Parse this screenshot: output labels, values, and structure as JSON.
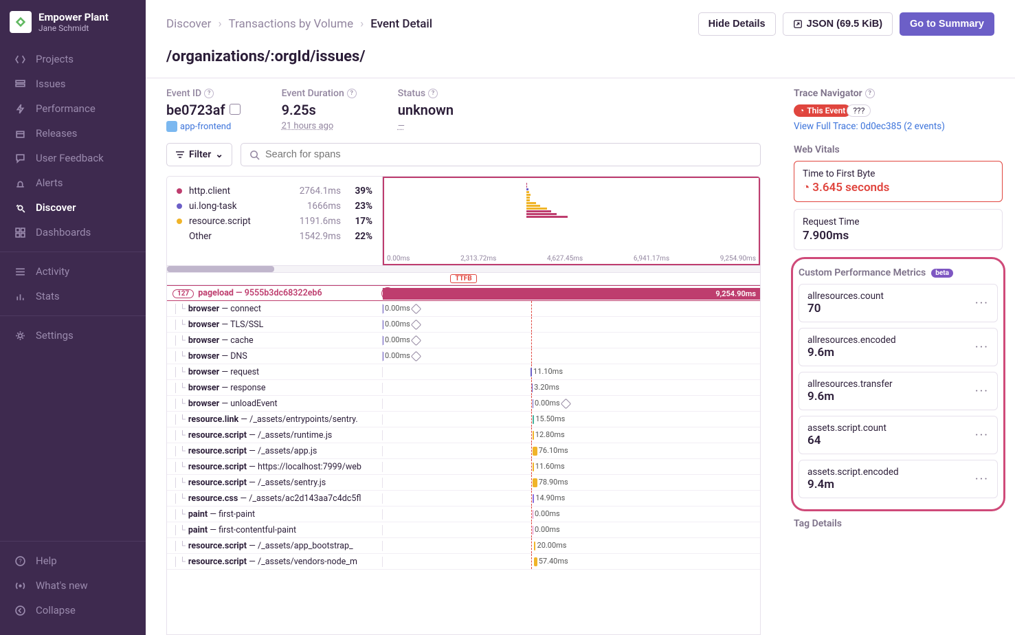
{
  "org": {
    "name": "Empower Plant",
    "user": "Jane Schmidt"
  },
  "nav": {
    "items": [
      {
        "label": "Projects",
        "icon": "code-brackets"
      },
      {
        "label": "Issues",
        "icon": "stack"
      },
      {
        "label": "Performance",
        "icon": "bolt"
      },
      {
        "label": "Releases",
        "icon": "box"
      },
      {
        "label": "User Feedback",
        "icon": "speech"
      },
      {
        "label": "Alerts",
        "icon": "siren"
      },
      {
        "label": "Discover",
        "icon": "telescope",
        "active": true
      },
      {
        "label": "Dashboards",
        "icon": "grid"
      }
    ],
    "group2": [
      {
        "label": "Activity",
        "icon": "list"
      },
      {
        "label": "Stats",
        "icon": "bar-chart"
      }
    ],
    "group3": [
      {
        "label": "Settings",
        "icon": "gear"
      }
    ],
    "footer": [
      {
        "label": "Help",
        "icon": "help"
      },
      {
        "label": "What's new",
        "icon": "broadcast"
      },
      {
        "label": "Collapse",
        "icon": "chevron-left"
      }
    ]
  },
  "breadcrumb": [
    "Discover",
    "Transactions by Volume",
    "Event Detail"
  ],
  "actions": {
    "hide": "Hide Details",
    "json": "JSON (69.5 KiB)",
    "summary": "Go to Summary"
  },
  "page_title": "/organizations/:orgId/issues/",
  "meta": {
    "event_id": {
      "label": "Event ID",
      "value": "be0723af",
      "project": "app-frontend"
    },
    "duration": {
      "label": "Event Duration",
      "value": "9.25s",
      "sub": "21 hours ago"
    },
    "status": {
      "label": "Status",
      "value": "unknown",
      "sub": "—"
    }
  },
  "filter": {
    "label": "Filter"
  },
  "search": {
    "placeholder": "Search for spans"
  },
  "ops_breakdown": [
    {
      "name": "http.client",
      "ms": "2764.1ms",
      "pct": "39%",
      "color": "#be3d6e"
    },
    {
      "name": "ui.long-task",
      "ms": "1666ms",
      "pct": "23%",
      "color": "#6c5fc7"
    },
    {
      "name": "resource.script",
      "ms": "1191.6ms",
      "pct": "17%",
      "color": "#f0b429"
    },
    {
      "name": "Other",
      "ms": "1542.9ms",
      "pct": "22%",
      "color": "transparent"
    }
  ],
  "mini_axis": [
    "0.00ms",
    "2,313.72ms",
    "4,627.45ms",
    "6,941.17ms",
    "9,254.90ms"
  ],
  "ttfb_label": "TTFB",
  "pageload": {
    "count": "127",
    "label": "pageload",
    "id": "9555b3dc68322eb6",
    "total": "9,254.90ms"
  },
  "spans": [
    {
      "op": "browser",
      "desc": "connect",
      "offset": 0,
      "w": 0,
      "ms": "0.00ms",
      "warn": true,
      "color": "#6c5fc7"
    },
    {
      "op": "browser",
      "desc": "TLS/SSL",
      "offset": 0,
      "w": 0,
      "ms": "0.00ms",
      "warn": true,
      "color": "#6c5fc7"
    },
    {
      "op": "browser",
      "desc": "cache",
      "offset": 0,
      "w": 0,
      "ms": "0.00ms",
      "warn": true,
      "color": "#6c5fc7"
    },
    {
      "op": "browser",
      "desc": "DNS",
      "offset": 0,
      "w": 0,
      "ms": "0.00ms",
      "warn": true,
      "color": "#6c5fc7"
    },
    {
      "op": "browser",
      "desc": "request",
      "offset": 39.2,
      "w": 0.3,
      "ms": "11.10ms",
      "color": "#6c5fc7"
    },
    {
      "op": "browser",
      "desc": "response",
      "offset": 39.5,
      "w": 0.2,
      "ms": "3.20ms",
      "color": "#6c5fc7"
    },
    {
      "op": "browser",
      "desc": "unloadEvent",
      "offset": 39.7,
      "w": 0,
      "ms": "0.00ms",
      "warn": true,
      "color": "#6c5fc7"
    },
    {
      "op": "resource.link",
      "desc": "/_assets/entrypoints/sentry.",
      "offset": 39.7,
      "w": 0.4,
      "ms": "15.50ms",
      "color": "#46b29d"
    },
    {
      "op": "resource.script",
      "desc": "/_assets/runtime.js",
      "offset": 39.7,
      "w": 0.3,
      "ms": "12.80ms",
      "color": "#f0b429"
    },
    {
      "op": "resource.script",
      "desc": "/_assets/app.js",
      "offset": 39.7,
      "w": 1.2,
      "ms": "76.10ms",
      "color": "#f0b429"
    },
    {
      "op": "resource.script",
      "desc": "https://localhost:7999/web",
      "offset": 39.7,
      "w": 0.3,
      "ms": "11.60ms",
      "color": "#f0b429"
    },
    {
      "op": "resource.script",
      "desc": "/_assets/sentry.js",
      "offset": 39.7,
      "w": 1.2,
      "ms": "78.90ms",
      "color": "#f0b429"
    },
    {
      "op": "resource.css",
      "desc": "/_assets/ac2d143aa7c4dc5fl",
      "offset": 39.7,
      "w": 0.4,
      "ms": "14.90ms",
      "color": "#8c6fe0"
    },
    {
      "op": "paint",
      "desc": "first-paint",
      "offset": 39.7,
      "w": 0,
      "ms": "0.00ms",
      "color": "#e07bc2"
    },
    {
      "op": "paint",
      "desc": "first-contentful-paint",
      "offset": 39.7,
      "w": 0,
      "ms": "0.00ms",
      "color": "#e07bc2"
    },
    {
      "op": "resource.script",
      "desc": "/_assets/app_bootstrap_",
      "offset": 40.0,
      "w": 0.5,
      "ms": "20.00ms",
      "color": "#f0b429"
    },
    {
      "op": "resource.script",
      "desc": "/_assets/vendors-node_m",
      "offset": 40.0,
      "w": 0.9,
      "ms": "57.40ms",
      "color": "#f0b429"
    }
  ],
  "trace_nav": {
    "title": "Trace Navigator",
    "chip": "This Event",
    "q": "???",
    "link": "View Full Trace: 0d0ec385 (2 events)"
  },
  "web_vitals": {
    "title": "Web Vitals",
    "ttfb": {
      "k": "Time to First Byte",
      "v": "3.645 seconds"
    },
    "req": {
      "k": "Request Time",
      "v": "7.900ms"
    }
  },
  "custom_metrics": {
    "title": "Custom Performance Metrics",
    "badge": "beta",
    "items": [
      {
        "k": "allresources.count",
        "v": "70"
      },
      {
        "k": "allresources.encoded",
        "v": "9.6m"
      },
      {
        "k": "allresources.transfer",
        "v": "9.6m"
      },
      {
        "k": "assets.script.count",
        "v": "64"
      },
      {
        "k": "assets.script.encoded",
        "v": "9.4m"
      }
    ]
  },
  "tag_details": {
    "title": "Tag Details"
  }
}
